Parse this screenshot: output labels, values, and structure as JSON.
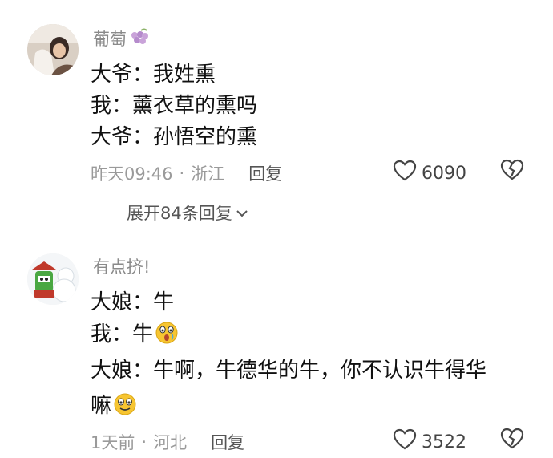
{
  "comments": [
    {
      "username": "葡萄",
      "username_icon": "grape-icon",
      "lines": [
        "大爷：我姓熏",
        "我：薰衣草的熏吗",
        "大爷：孙悟空的熏"
      ],
      "time": "昨天09:46",
      "location": "浙江",
      "reply_label": "回复",
      "likes": "6090"
    },
    {
      "username": "有点挤!",
      "lines": [
        "大娘：牛",
        "我：牛",
        "大娘：牛啊，牛德华的牛，你不认识牛得华",
        "嘛"
      ],
      "time": "1天前",
      "location": "河北",
      "reply_label": "回复",
      "likes": "3522"
    }
  ],
  "expand_replies": "展开84条回复",
  "colors": {
    "meta": "#9a9a9a",
    "text": "#111111",
    "emoji": "#f7c531"
  }
}
